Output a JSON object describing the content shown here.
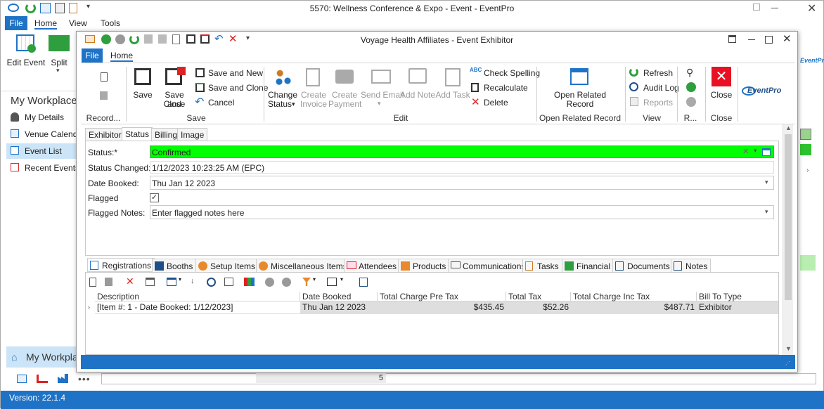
{
  "outer": {
    "title": "5570: Wellness Conference & Expo - Event - EventPro",
    "tabs": {
      "file": "File",
      "home": "Home",
      "view": "View",
      "tools": "Tools"
    },
    "ribbon": {
      "edit_event": "Edit Event",
      "split": "Split"
    },
    "workplace": {
      "header": "My Workplace",
      "items": [
        "My Details",
        "Venue Calendar",
        "Event List",
        "Recent Events"
      ],
      "bottom_header": "My Workplace"
    },
    "status": "Version: 22.1.4",
    "page_number": "5",
    "logo": "EventPro"
  },
  "inner": {
    "title": "Voyage Health Affiliates - Event Exhibitor",
    "tabs": {
      "file": "File",
      "home": "Home"
    },
    "ribbon": {
      "record_group": "Record...",
      "save": "Save",
      "save_close_1": "Save and",
      "save_close_2": "Close",
      "save_new": "Save and New",
      "save_clone": "Save and Clone",
      "cancel": "Cancel",
      "save_group": "Save",
      "change_status_1": "Change",
      "change_status_2": "Status",
      "create_invoice_1": "Create",
      "create_invoice_2": "Invoice",
      "create_payment_1": "Create",
      "create_payment_2": "Payment",
      "send_email": "Send Email",
      "add_note": "Add Note",
      "add_task": "Add Task",
      "check_spelling": "Check Spelling",
      "recalculate": "Recalculate",
      "delete": "Delete",
      "edit_group": "Edit",
      "open_related_1": "Open Related",
      "open_related_2": "Record",
      "open_related_group": "Open Related Record",
      "refresh": "Refresh",
      "audit_log": "Audit Log",
      "reports": "Reports",
      "view_group": "View",
      "r_group": "R...",
      "close": "Close",
      "close_group": "Close",
      "logo": "EventPro"
    },
    "detail_tabs": [
      "Exhibitor",
      "Status",
      "Billing",
      "Image"
    ],
    "fields": {
      "status_label": "Status:*",
      "status_value": "Confirmed",
      "status_changed_label": "Status Changed:",
      "status_changed_value": "1/12/2023 10:23:25 AM (EPC)",
      "date_booked_label": "Date Booked:",
      "date_booked_value": "Thu Jan 12 2023",
      "flagged_label": "Flagged",
      "flagged_checked": true,
      "flagged_notes_label": "Flagged Notes:",
      "flagged_notes_placeholder": "Enter flagged notes here"
    },
    "bottom_tabs": [
      "Registrations",
      "Booths",
      "Setup Items",
      "Miscellaneous Items",
      "Attendees",
      "Products",
      "Communications",
      "Tasks",
      "Financial",
      "Documents",
      "Notes"
    ],
    "grid": {
      "columns": [
        "Description",
        "Date Booked",
        "Total Charge Pre Tax",
        "Total Tax",
        "Total Charge Inc Tax",
        "Bill To Type"
      ],
      "rows": [
        [
          "[Item #: 1 - Date Booked: 1/12/2023]",
          "Thu Jan 12 2023",
          "$435.45",
          "$52.26",
          "$487.71",
          "Exhibitor"
        ]
      ]
    }
  },
  "colors": {
    "accent": "#1f73c6",
    "status_green": "#00ff00",
    "close_red": "#e81123"
  }
}
